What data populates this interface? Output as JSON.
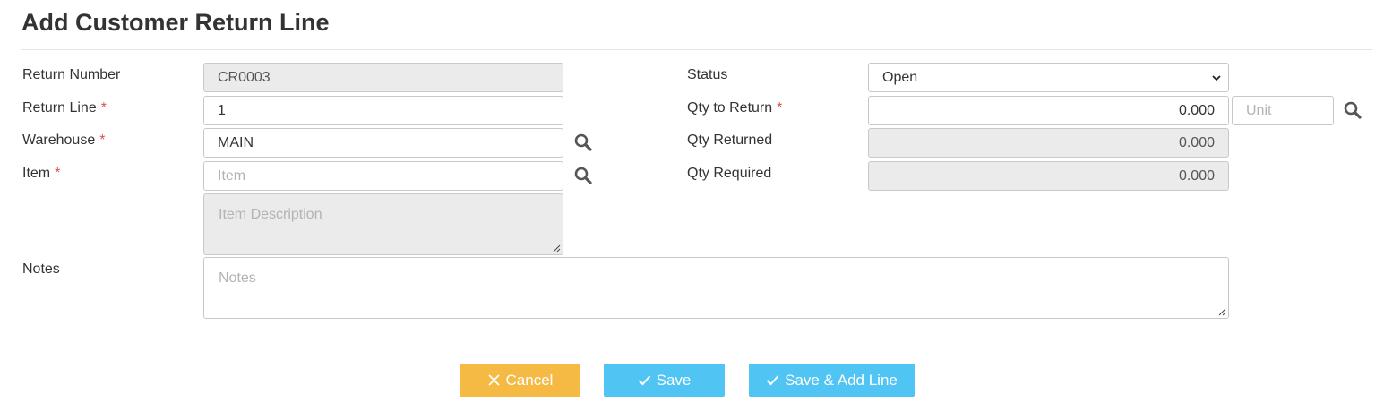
{
  "page": {
    "title": "Add Customer Return Line"
  },
  "form": {
    "return_number": {
      "label": "Return Number",
      "value": "CR0003"
    },
    "return_line": {
      "label": "Return Line",
      "value": "1",
      "required_mark": "*"
    },
    "warehouse": {
      "label": "Warehouse",
      "value": "MAIN",
      "required_mark": "*"
    },
    "item": {
      "label": "Item",
      "placeholder": "Item",
      "required_mark": "*"
    },
    "item_description": {
      "placeholder": "Item Description"
    },
    "notes": {
      "label": "Notes",
      "placeholder": "Notes"
    },
    "status": {
      "label": "Status",
      "value": "Open"
    },
    "qty_to_return": {
      "label": "Qty to Return",
      "value": "0.000",
      "required_mark": "*",
      "unit_placeholder": "Unit"
    },
    "qty_returned": {
      "label": "Qty Returned",
      "value": "0.000"
    },
    "qty_required": {
      "label": "Qty Required",
      "value": "0.000"
    }
  },
  "buttons": {
    "cancel": "Cancel",
    "save": "Save",
    "save_add_line": "Save & Add Line"
  },
  "colors": {
    "cancel": "#f4ba44",
    "save": "#50c4f2",
    "required": "#d9534f",
    "readonly_bg": "#ebebeb"
  },
  "icons": {
    "search": "search-icon",
    "check": "check-icon",
    "close": "close-icon",
    "caret": "chevron-down-icon",
    "grip": "resize-grip-icon"
  }
}
